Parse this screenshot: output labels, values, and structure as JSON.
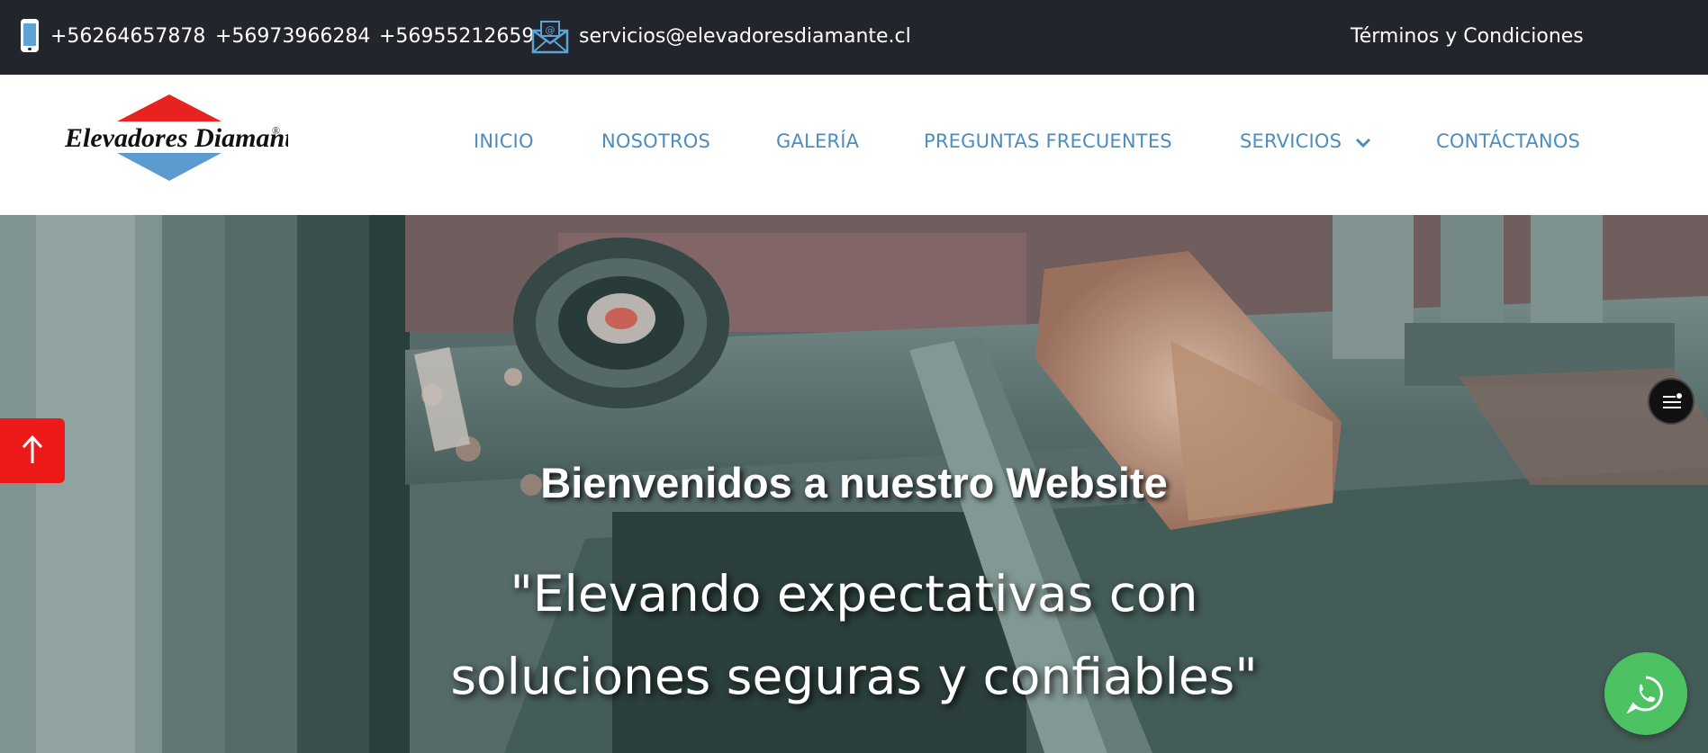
{
  "topbar": {
    "phones": [
      "+56264657878",
      "+56973966284",
      "+56955212659"
    ],
    "email": "servicios@elevadoresdiamante.cl",
    "terms_label": "Términos y Condiciones",
    "phone_icon": "phone-icon",
    "mail_icon": "mail-icon"
  },
  "header": {
    "logo_text": "Elevadores Diamante",
    "logo_mark": "®",
    "nav": [
      {
        "label": "INICIO"
      },
      {
        "label": "NOSOTROS"
      },
      {
        "label": "GALERÍA"
      },
      {
        "label": "PREGUNTAS FRECUENTES"
      },
      {
        "label": "SERVICIOS"
      },
      {
        "label": "CONTÁCTANOS"
      }
    ]
  },
  "hero": {
    "title": "Bienvenidos a nuestro Website",
    "subtitle": "\"Elevando expectativas con soluciones seguras y confiables\""
  },
  "colors": {
    "topbar_bg": "#22252b",
    "nav_text": "#4d8dbe",
    "logo_red": "#e8231f",
    "logo_blue": "#5b9bd0",
    "back_to_top": "#ee1a1a",
    "whatsapp": "#4dc262"
  },
  "floating": {
    "back_to_top_icon": "arrow-up-icon",
    "side_menu_icon": "menu-icon",
    "whatsapp_icon": "whatsapp-icon"
  }
}
